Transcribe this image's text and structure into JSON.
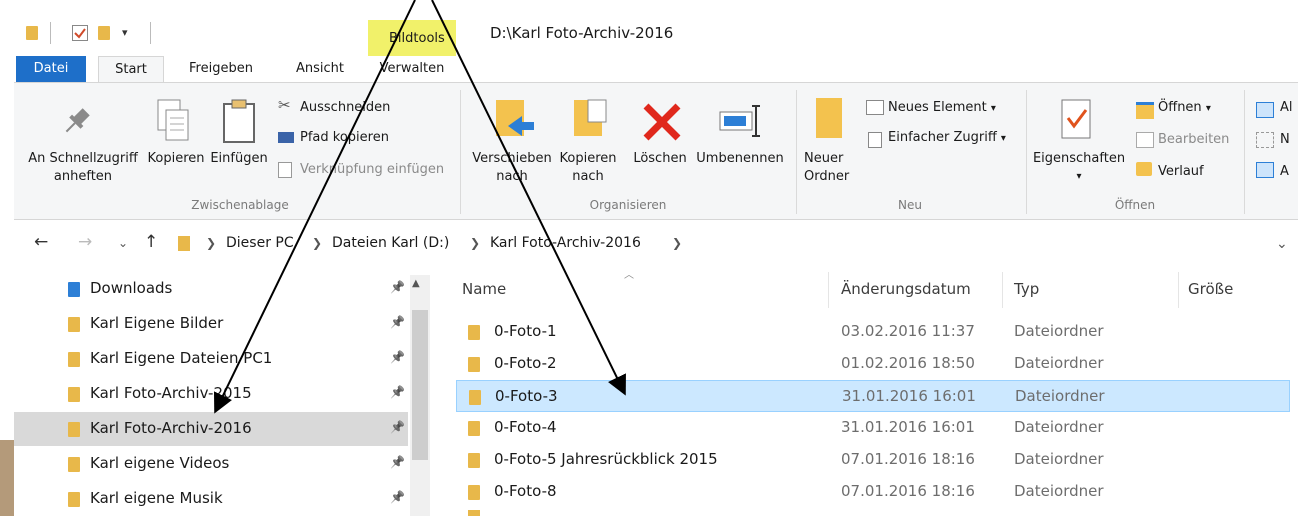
{
  "window": {
    "path_title": "D:\\Karl Foto-Archiv-2016",
    "context_tab": "Bildtools"
  },
  "tabs": [
    "Datei",
    "Start",
    "Freigeben",
    "Ansicht",
    "Verwalten"
  ],
  "ribbon": {
    "zwischenablage": {
      "label": "Zwischenablage",
      "pin_quick_line1": "An Schnellzugriff",
      "pin_quick_line2": "anheften",
      "copy": "Kopieren",
      "paste": "Einfügen",
      "cut": "Ausschneiden",
      "copy_path": "Pfad kopieren",
      "paste_shortcut": "Verknüpfung einfügen"
    },
    "organisieren": {
      "label": "Organisieren",
      "move_line1": "Verschieben",
      "move_line2": "nach",
      "copyto_line1": "Kopieren",
      "copyto_line2": "nach",
      "delete": "Löschen",
      "rename": "Umbenennen"
    },
    "neu": {
      "label": "Neu",
      "new_folder_line1": "Neuer",
      "new_folder_line2": "Ordner",
      "new_item": "Neues Element",
      "easy_access": "Einfacher Zugriff"
    },
    "oeffnen": {
      "label": "Öffnen",
      "properties": "Eigenschaften",
      "open": "Öffnen",
      "edit": "Bearbeiten",
      "history": "Verlauf"
    },
    "partial": [
      "Al",
      "N",
      "A"
    ]
  },
  "address": {
    "crumbs": [
      "Dieser PC",
      "Dateien Karl (D:)",
      "Karl Foto-Archiv-2016"
    ]
  },
  "nav": [
    {
      "label": "Downloads",
      "selected": false
    },
    {
      "label": "Karl Eigene Bilder",
      "selected": false
    },
    {
      "label": "Karl Eigene Dateien PC1",
      "selected": false
    },
    {
      "label": "Karl Foto-Archiv-2015",
      "selected": false
    },
    {
      "label": "Karl Foto-Archiv-2016",
      "selected": true
    },
    {
      "label": "Karl eigene Videos",
      "selected": false
    },
    {
      "label": "Karl eigene Musik",
      "selected": false
    }
  ],
  "columns": {
    "name": "Name",
    "date": "Änderungsdatum",
    "type": "Typ",
    "size": "Größe"
  },
  "files": [
    {
      "name": "0-Foto-1",
      "date": "03.02.2016 11:37",
      "type": "Dateiordner",
      "selected": false
    },
    {
      "name": "0-Foto-2",
      "date": "01.02.2016 18:50",
      "type": "Dateiordner",
      "selected": false
    },
    {
      "name": "0-Foto-3",
      "date": "31.01.2016 16:01",
      "type": "Dateiordner",
      "selected": true
    },
    {
      "name": "0-Foto-4",
      "date": "31.01.2016 16:01",
      "type": "Dateiordner",
      "selected": false
    },
    {
      "name": "0-Foto-5 Jahresrückblick 2015",
      "date": "07.01.2016 18:16",
      "type": "Dateiordner",
      "selected": false
    },
    {
      "name": "0-Foto-8",
      "date": "07.01.2016 18:16",
      "type": "Dateiordner",
      "selected": false
    }
  ],
  "colors": {
    "accent": "#1e6fc9",
    "selection": "#cce8ff",
    "folder": "#e8b84a",
    "delete": "#e0281c",
    "highlight": "#f1f16a"
  }
}
